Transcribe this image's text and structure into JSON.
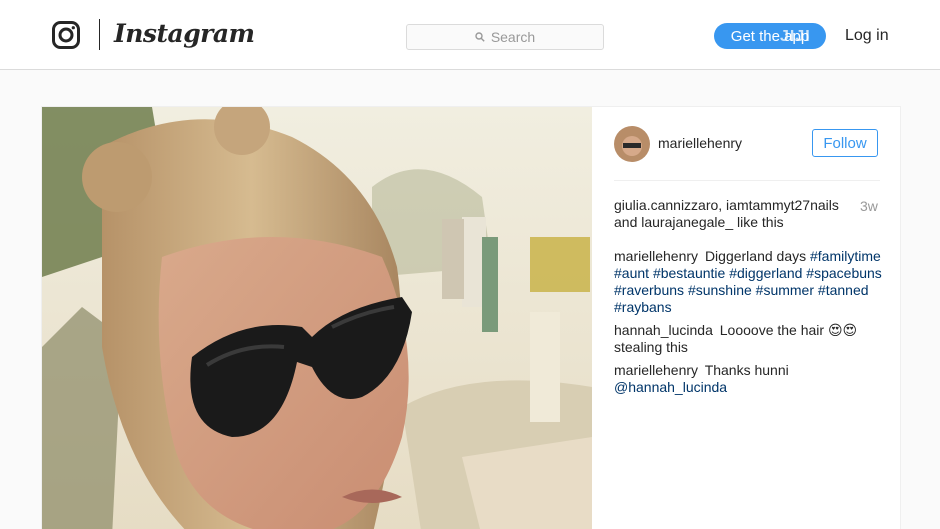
{
  "header": {
    "brand": "Instagram",
    "search_placeholder": "Search",
    "get_app_label": "Get the app",
    "watermark": "JIJI",
    "login_label": "Log in"
  },
  "post": {
    "username": "mariellehenry",
    "follow_label": "Follow",
    "likes_text": "giulia.cannizzaro, iamtammyt27nails and laurajanegale_ like this",
    "age": "3w",
    "caption": {
      "user": "mariellehenry",
      "text": "Diggerland days",
      "hashtags": [
        "#familytime",
        "#aunt",
        "#bestauntie",
        "#diggerland",
        "#spacebuns",
        "#raverbuns",
        "#sunshine",
        "#summer",
        "#tanned",
        "#raybans"
      ]
    },
    "comments": [
      {
        "user": "hannah_lucinda",
        "text": "Loooove the hair 😍😍 stealing this"
      },
      {
        "user": "mariellehenry",
        "text": "Thanks hunni",
        "mention": "@hannah_lucinda"
      }
    ]
  },
  "colors": {
    "accent": "#3897f0",
    "hashtag": "#003569",
    "border": "#dbdbdb",
    "background": "#fafafa"
  }
}
